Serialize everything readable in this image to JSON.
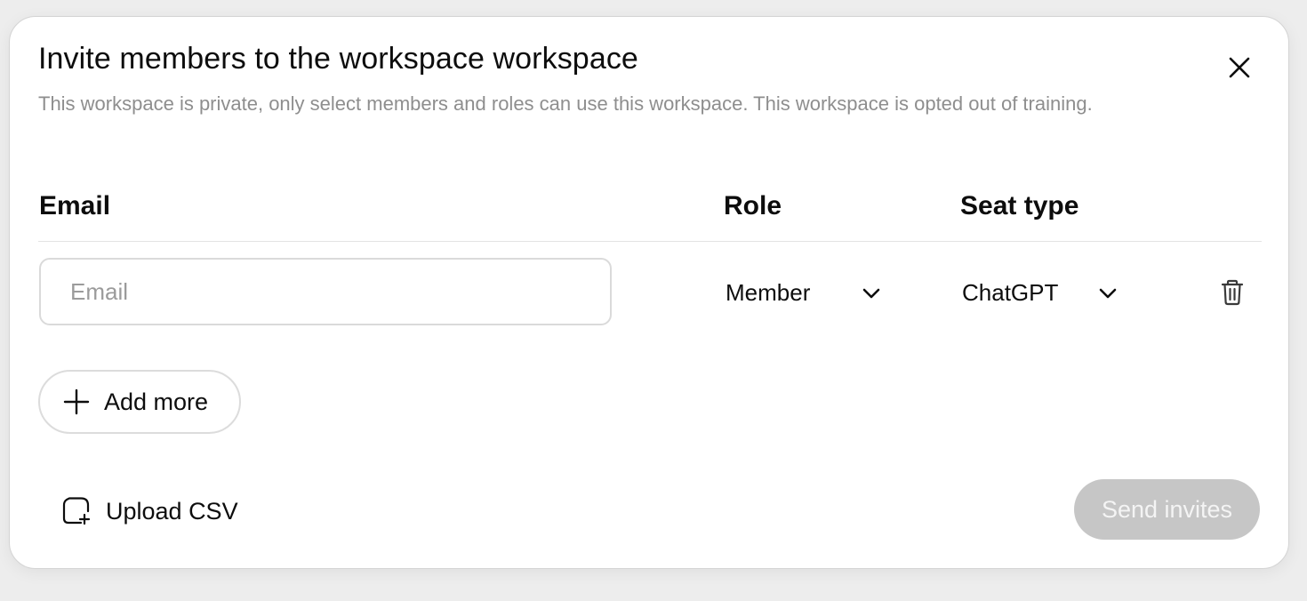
{
  "dialog": {
    "title": "Invite members to the workspace workspace",
    "description": "This workspace is private, only select members and roles can use this workspace. This workspace is opted out of training.",
    "close_icon": "close-icon"
  },
  "table": {
    "headers": {
      "email": "Email",
      "role": "Role",
      "seat_type": "Seat type"
    },
    "rows": [
      {
        "email_value": "",
        "email_placeholder": "Email",
        "role": "Member",
        "seat_type": "ChatGPT",
        "delete_icon": "trash-icon"
      }
    ]
  },
  "actions": {
    "add_more_label": "Add more",
    "add_more_icon": "plus-icon",
    "upload_label": "Upload CSV",
    "upload_icon": "upload-file-icon",
    "send_label": "Send invites",
    "send_disabled": true
  },
  "colors": {
    "text_primary": "#0d0d0d",
    "text_secondary": "#8e8e8e",
    "button_disabled_bg": "#c6c6c6",
    "button_disabled_text": "#f4f4f4",
    "border": "#dadada",
    "backdrop": "#ededed"
  }
}
